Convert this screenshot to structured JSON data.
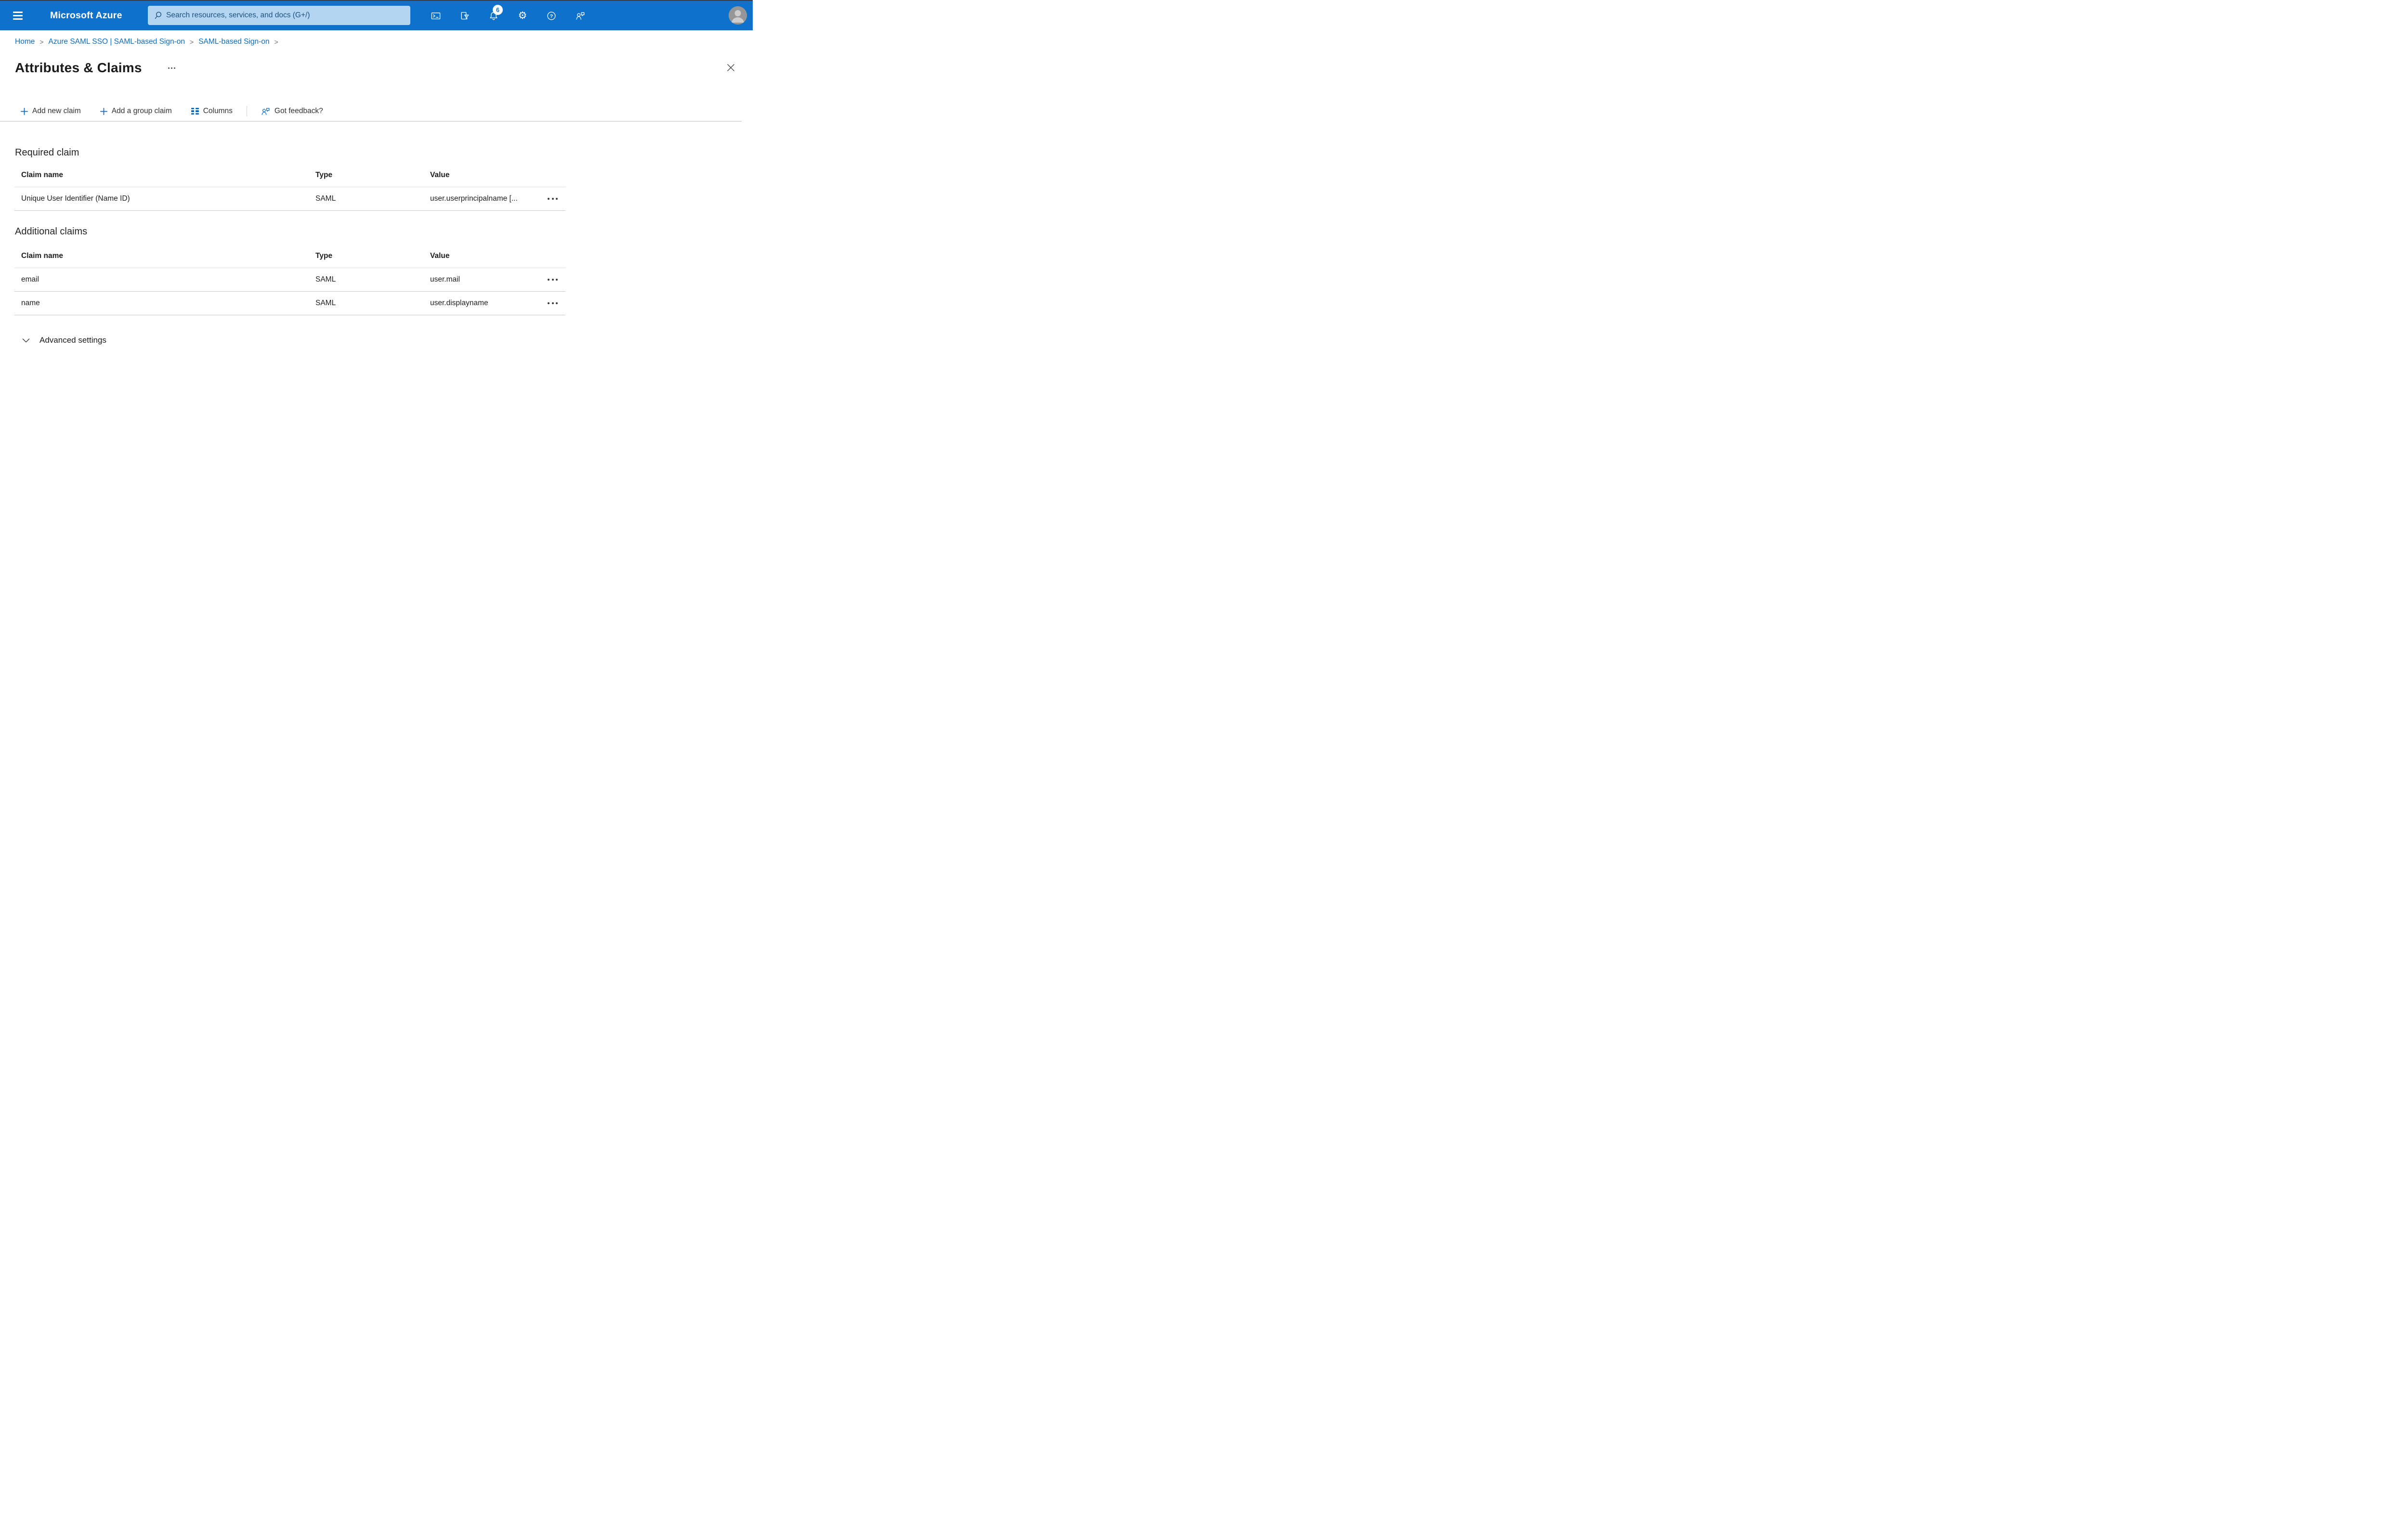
{
  "topbar": {
    "brand": "Microsoft Azure",
    "search_placeholder": "Search resources, services, and docs (G+/)",
    "notification_count": "6",
    "icons": [
      "hamburger-menu",
      "search",
      "cloud-shell",
      "directory-filter",
      "notifications-bell",
      "settings-gear",
      "help",
      "feedback",
      "avatar"
    ],
    "colors": {
      "background": "#0e72cc",
      "search_background": "#b3d5f2",
      "search_text": "#1c527f"
    }
  },
  "breadcrumb": {
    "separator": ">",
    "items": [
      {
        "label": "Home"
      },
      {
        "label": "Azure SAML SSO | SAML-based Sign-on"
      },
      {
        "label": "SAML-based Sign-on"
      }
    ]
  },
  "page": {
    "title": "Attributes & Claims",
    "title_menu_icon": "ellipsis-horizontal",
    "close_icon": "close-x"
  },
  "toolbar": {
    "buttons": [
      {
        "label": "Add new claim",
        "icon": "plus-icon"
      },
      {
        "label": "Add a group claim",
        "icon": "plus-icon"
      },
      {
        "label": "Columns",
        "icon": "columns-icon"
      }
    ],
    "feedback": {
      "label": "Got feedback?",
      "icon": "feedback-person-icon"
    }
  },
  "sections": [
    {
      "heading": "Required claim",
      "columns": [
        "Claim name",
        "Type",
        "Value"
      ],
      "rows": [
        {
          "claim_name": "Unique User Identifier (Name ID)",
          "type": "SAML",
          "value": "user.userprincipalname [...",
          "menu": "ellipsis-menu"
        }
      ]
    },
    {
      "heading": "Additional claims",
      "columns": [
        "Claim name",
        "Type",
        "Value"
      ],
      "rows": [
        {
          "claim_name": "email",
          "type": "SAML",
          "value": "user.mail",
          "menu": "ellipsis-menu"
        },
        {
          "claim_name": "name",
          "type": "SAML",
          "value": "user.displayname",
          "menu": "ellipsis-menu"
        }
      ]
    }
  ],
  "advanced": {
    "label": "Advanced settings",
    "state": "collapsed"
  },
  "colors": {
    "accent_blue": "#0f6cbd",
    "topbar_blue": "#0e72cc",
    "text_dark": "#252423",
    "border_light": "#e0e0e0",
    "border_mid": "#c9c9c9",
    "separator_gray": "#6b6b6b"
  }
}
